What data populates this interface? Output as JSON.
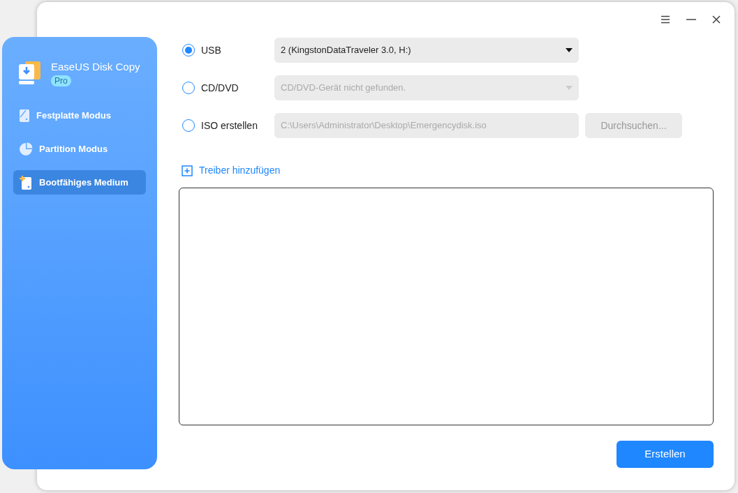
{
  "app": {
    "name": "EaseUS Disk Copy",
    "badge": "Pro"
  },
  "sidebar": {
    "items": [
      {
        "label": "Festplatte Modus",
        "selected": false
      },
      {
        "label": "Partition Modus",
        "selected": false
      },
      {
        "label": "Bootfähiges Medium",
        "selected": true
      }
    ]
  },
  "targets": [
    {
      "label": "USB",
      "selected": true,
      "kind": "dropdown",
      "value": "2 (KingstonDataTraveler 3.0, H:)",
      "disabled": false
    },
    {
      "label": "CD/DVD",
      "selected": false,
      "kind": "dropdown",
      "value": "CD/DVD-Gerät nicht gefunden.",
      "disabled": true
    },
    {
      "label": "ISO erstellen",
      "selected": false,
      "kind": "path",
      "value": "C:\\Users\\Administrator\\Desktop\\Emergencydisk.iso",
      "disabled": true,
      "button": "Durchsuchen..."
    }
  ],
  "add_driver": "Treiber hinzufügen",
  "create_button": "Erstellen"
}
